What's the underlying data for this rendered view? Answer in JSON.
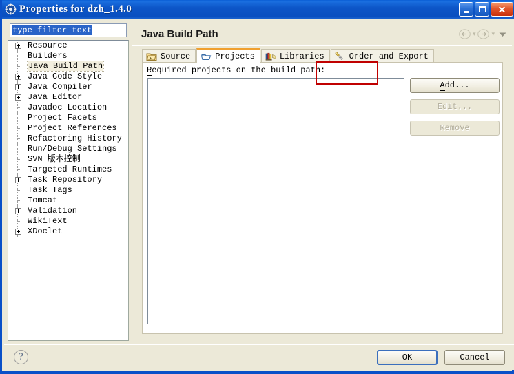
{
  "window": {
    "title": "Properties for dzh_1.4.0",
    "icon": "properties-gear-icon",
    "buttons": {
      "minimize": "minimize-icon",
      "maximize": "maximize-icon",
      "close": "close-icon"
    }
  },
  "sidebar": {
    "filter": {
      "value": "type filter text",
      "placeholder": "type filter text"
    },
    "items": [
      {
        "label": "Resource",
        "expandable": true,
        "selected": false
      },
      {
        "label": "Builders",
        "expandable": false,
        "selected": false
      },
      {
        "label": "Java Build Path",
        "expandable": false,
        "selected": true
      },
      {
        "label": "Java Code Style",
        "expandable": true,
        "selected": false
      },
      {
        "label": "Java Compiler",
        "expandable": true,
        "selected": false
      },
      {
        "label": "Java Editor",
        "expandable": true,
        "selected": false
      },
      {
        "label": "Javadoc Location",
        "expandable": false,
        "selected": false
      },
      {
        "label": "Project Facets",
        "expandable": false,
        "selected": false
      },
      {
        "label": "Project References",
        "expandable": false,
        "selected": false
      },
      {
        "label": "Refactoring History",
        "expandable": false,
        "selected": false
      },
      {
        "label": "Run/Debug Settings",
        "expandable": false,
        "selected": false
      },
      {
        "label": "SVN 版本控制",
        "expandable": false,
        "selected": false
      },
      {
        "label": "Targeted Runtimes",
        "expandable": false,
        "selected": false
      },
      {
        "label": "Task Repository",
        "expandable": true,
        "selected": false
      },
      {
        "label": "Task Tags",
        "expandable": false,
        "selected": false
      },
      {
        "label": "Tomcat",
        "expandable": false,
        "selected": false
      },
      {
        "label": "Validation",
        "expandable": true,
        "selected": false
      },
      {
        "label": "WikiText",
        "expandable": false,
        "selected": false
      },
      {
        "label": "XDoclet",
        "expandable": true,
        "selected": false
      }
    ]
  },
  "main": {
    "heading": "Java Build Path",
    "nav": {
      "back": "back-arrow-icon",
      "forward": "forward-arrow-icon",
      "menu": "chevron-down-icon"
    },
    "tabs": [
      {
        "label": "Source",
        "icon": "source-folder-icon",
        "active": false
      },
      {
        "label": "Projects",
        "icon": "projects-icon",
        "active": true
      },
      {
        "label": "Libraries",
        "icon": "libraries-books-icon",
        "active": false
      },
      {
        "label": "Order and Export",
        "icon": "order-export-icon",
        "active": false
      }
    ],
    "projects_tab": {
      "list_label": "Required projects on the build path:",
      "list_label_mnemonic": "R",
      "list_items": [],
      "buttons": [
        {
          "label": "Add...",
          "mnemonic": "A",
          "enabled": true
        },
        {
          "label": "Edit...",
          "mnemonic": "E",
          "enabled": false
        },
        {
          "label": "Remove",
          "mnemonic": "R",
          "enabled": false
        }
      ]
    }
  },
  "annotations": {
    "color": "#c00000",
    "highlights": [
      "projects-tab",
      "add-button"
    ]
  },
  "footer": {
    "help": "?",
    "ok_label": "OK",
    "cancel_label": "Cancel"
  }
}
